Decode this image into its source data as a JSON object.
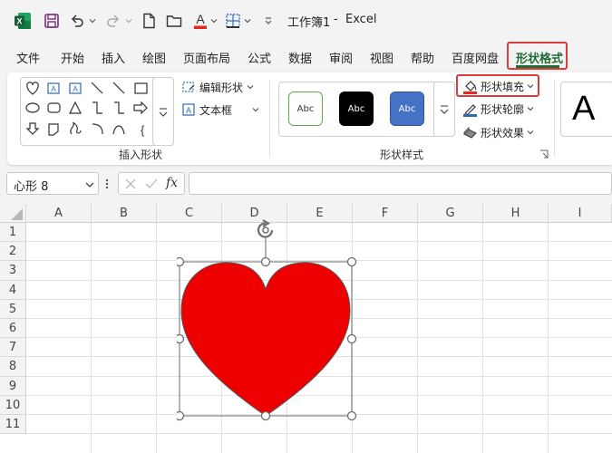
{
  "titlebar": {
    "title": "工作簿1",
    "separator": "-",
    "app": "Excel",
    "font_color_accent": "#e8251f"
  },
  "tabs": [
    {
      "label": "文件"
    },
    {
      "label": "开始"
    },
    {
      "label": "插入"
    },
    {
      "label": "绘图"
    },
    {
      "label": "页面布局"
    },
    {
      "label": "公式"
    },
    {
      "label": "数据"
    },
    {
      "label": "审阅"
    },
    {
      "label": "视图"
    },
    {
      "label": "帮助"
    },
    {
      "label": "百度网盘"
    },
    {
      "label": "形状格式",
      "active": true
    }
  ],
  "ribbon": {
    "insert_shapes": {
      "edit_shape": "编辑形状",
      "text_box": "文本框",
      "group_label": "插入形状"
    },
    "shape_styles": {
      "presets": [
        {
          "label": "Abc",
          "style": "outline-green"
        },
        {
          "label": "Abc",
          "style": "black-fill"
        },
        {
          "label": "Abc",
          "style": "blue-fill"
        }
      ],
      "fill": "形状填充",
      "outline": "形状轮廓",
      "effects": "形状效果",
      "group_label": "形状样式",
      "fill_color": "#e8251f"
    },
    "wordart_preview": "A"
  },
  "formula_bar": {
    "name_box": "心形 8",
    "fx": "fx",
    "value": ""
  },
  "sheet": {
    "columns": [
      "A",
      "B",
      "C",
      "D",
      "E",
      "F",
      "G",
      "H",
      "I"
    ],
    "rows": [
      "1",
      "2",
      "3",
      "4",
      "5",
      "6",
      "7",
      "8",
      "9",
      "10",
      "11"
    ]
  },
  "shape": {
    "type": "heart",
    "name": "心形 8",
    "fill": "#ee0000",
    "selected": true
  },
  "colors": {
    "accent_green": "#1e6b35",
    "highlight_red": "#e03a3a"
  }
}
